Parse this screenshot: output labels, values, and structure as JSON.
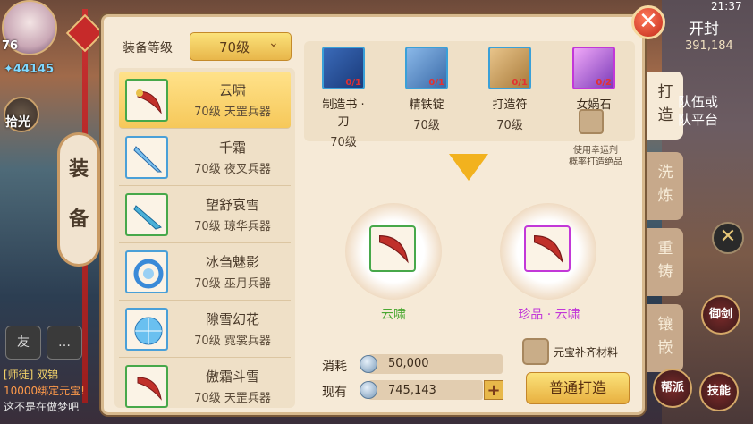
{
  "hud": {
    "player_level": "76",
    "power": "44145",
    "pickup_label": "拾光",
    "time": "21:37",
    "server_label": "开封",
    "server_number": "391,184",
    "team_line1": "队伍或",
    "team_line2": "队平台",
    "gang_label": "帮派",
    "skill_label": "技能",
    "sword_label": "御剑",
    "chat_friend": "友",
    "chat_line1": "[师徒] 双锦",
    "chat_line2": "10000绑定元宝!",
    "chat_line3": "这不是在做梦吧"
  },
  "side_tab": {
    "label_1": "装",
    "label_2": "备"
  },
  "panel": {
    "level_label": "装备等级",
    "level_value": "70级",
    "items": [
      {
        "name": "云啸",
        "desc": "70级 天罡兵器"
      },
      {
        "name": "千霜",
        "desc": "70级 夜叉兵器"
      },
      {
        "name": "望舒哀雪",
        "desc": "70级 琼华兵器"
      },
      {
        "name": "冰刍魅影",
        "desc": "70级 巫月兵器"
      },
      {
        "name": "隙雪幻花",
        "desc": "70级 霓裳兵器"
      },
      {
        "name": "傲霜斗雪",
        "desc": "70级 天罡兵器"
      }
    ],
    "materials": [
      {
        "name": "制造书 · 刀",
        "level": "70级",
        "count": "0/1"
      },
      {
        "name": "精铁锭",
        "level": "70级",
        "count": "0/1"
      },
      {
        "name": "打造符",
        "level": "70级",
        "count": "0/1"
      },
      {
        "name": "女娲石",
        "level": "",
        "count": "0/2"
      }
    ],
    "luck_hint_line1": "使用幸运剂",
    "luck_hint_line2": "概率打造绝品",
    "result_normal": "云啸",
    "result_rare": "珍品 · 云啸",
    "cost_label": "消耗",
    "cost_value": "50,000",
    "own_label": "现有",
    "own_value": "745,143",
    "yuanbao_label": "元宝补齐材料",
    "forge_button": "普通打造"
  },
  "tabs": [
    {
      "label_1": "打",
      "label_2": "造"
    },
    {
      "label_1": "洗",
      "label_2": "炼"
    },
    {
      "label_1": "重",
      "label_2": "铸"
    },
    {
      "label_1": "镶",
      "label_2": "嵌"
    }
  ],
  "colors": {
    "panel_bg": "#f6ead7",
    "selected_item": "#f6c85a",
    "normal_result": "#4aa832",
    "rare_result": "#c238d8",
    "forge_button": "#e8b040"
  }
}
